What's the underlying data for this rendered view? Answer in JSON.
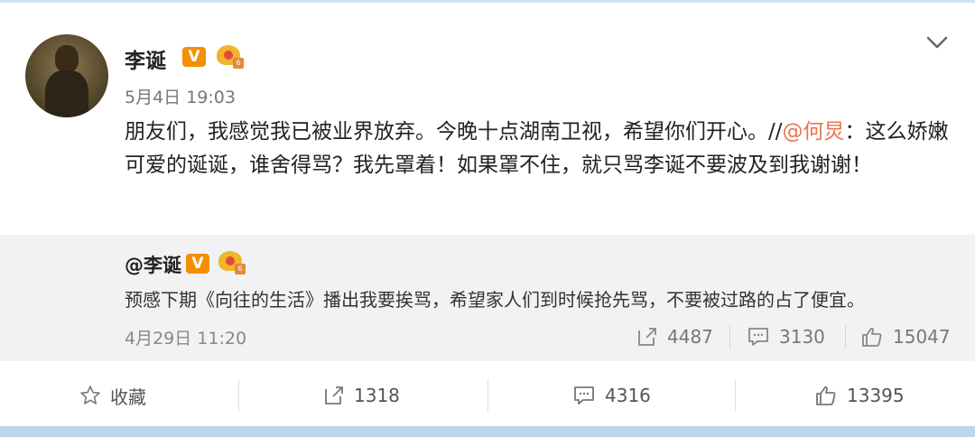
{
  "post": {
    "username": "李诞",
    "verified_badge": "V",
    "vip_level": "6",
    "timestamp": "5月4日 19:03",
    "content_part1": "朋友们，我感觉我已被业界放弃。今晚十点湖南卫视，希望你们开心。//",
    "mention": "@何炅",
    "content_part2": "：这么娇嫩可爱的诞诞，谁舍得骂？我先罩着！如果罩不住，就只骂李诞不要波及到我谢谢！",
    "icons": {
      "more": "chevron-down-icon"
    }
  },
  "quote": {
    "username": "@李诞",
    "verified_badge": "V",
    "vip_level": "6",
    "text": "预感下期《向往的生活》播出我要挨骂，希望家人们到时候抢先骂，不要被过路的占了便宜。",
    "time": "4月29日 11:20",
    "reposts": "4487",
    "comments": "3130",
    "likes": "15047"
  },
  "actions": {
    "favorite_label": "收藏",
    "reposts": "1318",
    "comments": "4316",
    "likes": "13395"
  },
  "colors": {
    "mention": "#eb7350",
    "verified": "#f29100",
    "quote_bg": "#f2f2f5"
  }
}
